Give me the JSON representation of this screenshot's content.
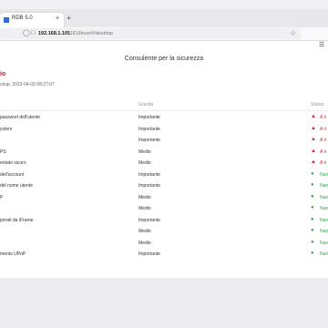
{
  "browser": {
    "tab_title": "RDB 5.0",
    "tab_close": "×",
    "new_tab": "+",
    "url_host": "192.168.1.101",
    "url_path": ":9181/linux/#/desktop"
  },
  "page": {
    "title": "Consulente per la sicurezza",
    "summary_title": "io",
    "backup_line": "ckup: 2023-04-03 08:27:07"
  },
  "table": {
    "headers": {
      "name": "",
      "severity": "Gravità",
      "status": "Status"
    },
    "rows": [
      {
        "name": "passwort dell'utente",
        "severity": "Importante",
        "status": "A ri",
        "state": "warn"
      },
      {
        "name": "ystem",
        "severity": "Importante",
        "status": "A ri",
        "state": "warn"
      },
      {
        "name": "",
        "severity": "Importante",
        "status": "A ri",
        "state": "warn"
      },
      {
        "name": "PS",
        "severity": "Medio",
        "status": "A ri",
        "state": "warn"
      },
      {
        "name": "entato sicuro",
        "severity": "Medio",
        "status": "A ri",
        "state": "warn"
      },
      {
        "name": "dell'account",
        "severity": "Importante",
        "status": "Nan",
        "state": "ok"
      },
      {
        "name": "del nome utente",
        "severity": "Importante",
        "status": "Nan",
        "state": "ok"
      },
      {
        "name": "P",
        "severity": "Medio",
        "status": "Nan",
        "state": "ok"
      },
      {
        "name": "",
        "severity": "Medio",
        "status": "Nan",
        "state": "ok"
      },
      {
        "name": "porati da iFrame",
        "severity": "Importante",
        "status": "Nan",
        "state": "ok"
      },
      {
        "name": "",
        "severity": "Medio",
        "status": "Nan",
        "state": "ok"
      },
      {
        "name": "",
        "severity": "Medio",
        "status": "Nan",
        "state": "ok"
      },
      {
        "name": "mento UPnP",
        "severity": "Importante",
        "status": "Nan",
        "state": "ok"
      }
    ]
  },
  "colors": {
    "warn": "#d9262c",
    "ok": "#2faa4a",
    "accent": "#c8102e"
  }
}
